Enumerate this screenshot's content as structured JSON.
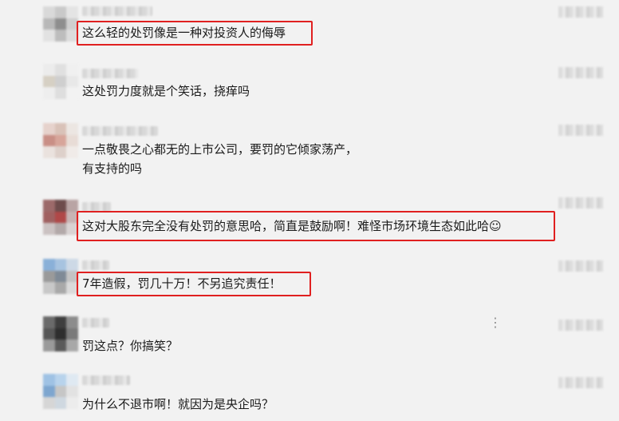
{
  "comments": [
    {
      "text": "这么轻的处罚像是一种对投资人的侮辱",
      "highlighted": true
    },
    {
      "text": "这处罚力度就是个笑话，挠痒吗",
      "highlighted": false
    },
    {
      "text": "一点敬畏之心都无的上市公司，要罚的它倾家荡产，\n有支持的吗",
      "highlighted": false
    },
    {
      "text": "这对大股东完全没有处罚的意思哈，简直是鼓励啊！难怪市场环境生态如此哈☺",
      "highlighted": true
    },
    {
      "text": "7年造假，罚几十万！不另追究责任！",
      "highlighted": true
    },
    {
      "text": "罚这点？你搞笑？",
      "highlighted": false
    },
    {
      "text": "为什么不退市啊！就因为是央企吗？",
      "highlighted": false
    }
  ],
  "more_icon": "⋮",
  "colors": {
    "highlight": "#e02020",
    "text": "#1a1a1a",
    "background": "#f2f2f2"
  }
}
